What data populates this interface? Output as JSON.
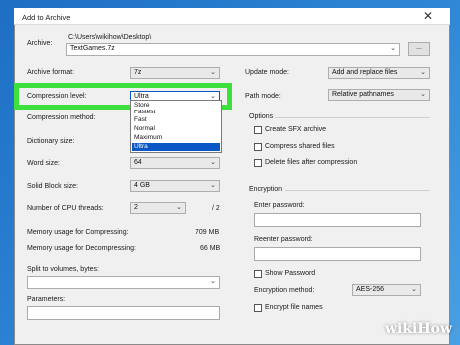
{
  "window": {
    "title": "Add to Archive",
    "close_glyph": "✕"
  },
  "archive": {
    "label": "Archive:",
    "path": "C:\\Users\\wikihow\\Desktop\\",
    "filename": "TextGames.7z",
    "browse_label": "..."
  },
  "left": {
    "archive_format": {
      "label": "Archive format:",
      "value": "7z"
    },
    "compression_level": {
      "label": "Compression level:",
      "value": "Ultra"
    },
    "compression_method": {
      "label": "Compression method:"
    },
    "dictionary_size": {
      "label": "Dictionary size:"
    },
    "word_size": {
      "label": "Word size:",
      "value": "64"
    },
    "solid_block": {
      "label": "Solid Block size:",
      "value": "4 GB"
    },
    "cpu_threads": {
      "label": "Number of CPU threads:",
      "value": "2",
      "total": "/ 2"
    },
    "mem_compress": {
      "label": "Memory usage for Compressing:",
      "value": "709 MB"
    },
    "mem_decompress": {
      "label": "Memory usage for Decompressing:",
      "value": "66 MB"
    },
    "split": {
      "label": "Split to volumes, bytes:"
    },
    "parameters": {
      "label": "Parameters:"
    }
  },
  "dropdown": {
    "items": [
      "Store",
      "Fastest",
      "Fast",
      "Normal",
      "Maximum",
      "Ultra"
    ],
    "selected": "Ultra"
  },
  "right": {
    "update_mode": {
      "label": "Update mode:",
      "value": "Add and replace files"
    },
    "path_mode": {
      "label": "Path mode:",
      "value": "Relative pathnames"
    },
    "options": {
      "title": "Options",
      "create_sfx": "Create SFX archive",
      "compress_shared": "Compress shared files",
      "delete_after": "Delete files after compression"
    },
    "encryption": {
      "title": "Encryption",
      "enter_password": "Enter password:",
      "reenter_password": "Reenter password:",
      "show_password": "Show Password",
      "method_label": "Encryption method:",
      "method_value": "AES-256",
      "encrypt_names": "Encrypt file names"
    }
  },
  "watermark": {
    "wiki": "wiki",
    "how": "How"
  },
  "colors": {
    "highlight": "#3de03d",
    "selection": "#0b57c6",
    "desktop": "#2f86d6"
  }
}
